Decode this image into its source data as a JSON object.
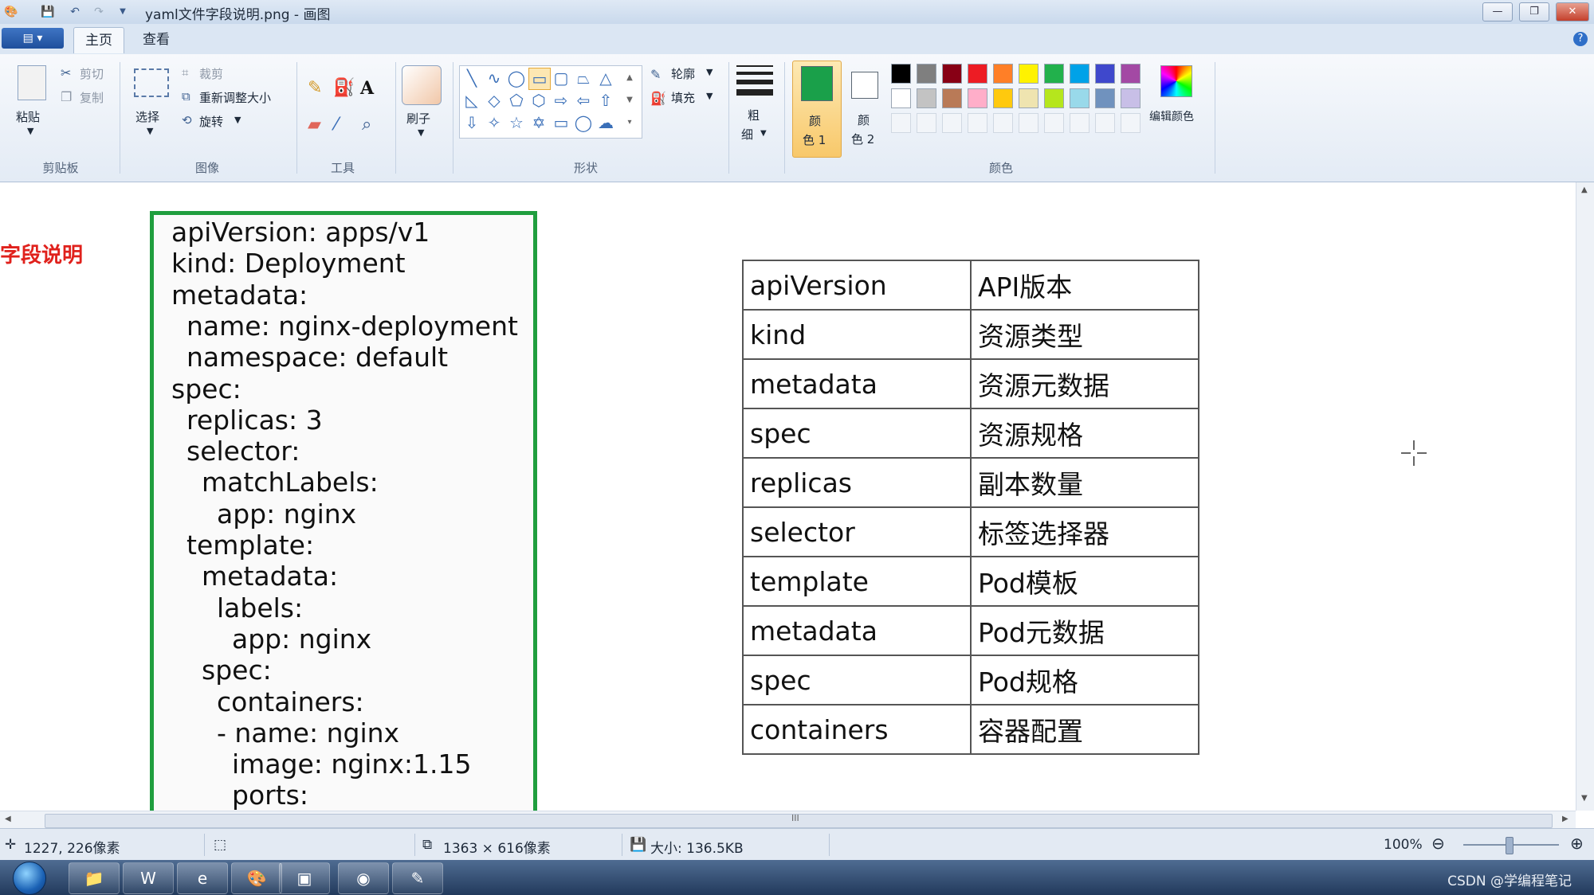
{
  "window": {
    "title": "yaml文件字段说明.png - 画图",
    "controls": {
      "minimize": "—",
      "restore": "❐",
      "close": "✕"
    }
  },
  "quick_access": {
    "icons": [
      "paint-app-icon",
      "save-icon",
      "undo-icon",
      "redo-icon",
      "customize-dropdown-icon"
    ]
  },
  "ribbon_tabs": {
    "app_menu": "▤ ▾",
    "home": "主页",
    "view": "查看",
    "help": "?"
  },
  "ribbon": {
    "clipboard": {
      "paste": "粘贴",
      "cut": "剪切",
      "copy": "复制",
      "group": "剪贴板"
    },
    "image": {
      "select": "选择",
      "crop": "裁剪",
      "resize": "重新调整大小",
      "rotate": "旋转",
      "group": "图像"
    },
    "tools": {
      "group": "工具"
    },
    "brush": {
      "label": "刷子"
    },
    "shapes": {
      "outline": "轮廓",
      "fill": "填充",
      "group": "形状"
    },
    "size": {
      "line1": "粗",
      "line2": "细"
    },
    "color1": {
      "line1": "颜",
      "line2": "色 1",
      "value": "#1aa04a"
    },
    "color2": {
      "line1": "颜",
      "line2": "色 2",
      "value": "#ffffff"
    },
    "edit_colors": "编辑颜色",
    "colors_group": "颜色",
    "palette_row1": [
      "#000000",
      "#7f7f7f",
      "#880015",
      "#ed1c24",
      "#ff7f27",
      "#fff200",
      "#22b14c",
      "#00a2e8",
      "#3f48cc",
      "#a349a4"
    ],
    "palette_row2": [
      "#ffffff",
      "#c3c3c3",
      "#b97a57",
      "#ffaec9",
      "#ffc90e",
      "#efe4b0",
      "#b5e61d",
      "#99d9ea",
      "#7092be",
      "#c8bfe7"
    ]
  },
  "side_title": "字段说明",
  "yaml_lines": [
    "apiVersion: apps/v1",
    "kind: Deployment",
    "metadata:",
    "  name: nginx-deployment",
    "  namespace: default",
    "spec:",
    "  replicas: 3",
    "  selector:",
    "    matchLabels:",
    "      app: nginx",
    "  template:",
    "    metadata:",
    "      labels:",
    "        app: nginx",
    "    spec:",
    "      containers:",
    "      - name: nginx",
    "        image: nginx:1.15",
    "        ports:"
  ],
  "field_table": [
    {
      "field": "apiVersion",
      "desc": "API版本"
    },
    {
      "field": "kind",
      "desc": "资源类型"
    },
    {
      "field": "metadata",
      "desc": "资源元数据"
    },
    {
      "field": "spec",
      "desc": "资源规格"
    },
    {
      "field": "replicas",
      "desc": "副本数量"
    },
    {
      "field": "selector",
      "desc": "标签选择器"
    },
    {
      "field": "template",
      "desc": "Pod模板"
    },
    {
      "field": "metadata",
      "desc": "Pod元数据"
    },
    {
      "field": "spec",
      "desc": "Pod规格"
    },
    {
      "field": "containers",
      "desc": "容器配置"
    }
  ],
  "statusbar": {
    "cursor_pos": "1227, 226像素",
    "image_size": "1363 × 616像素",
    "file_size": "大小: 136.5KB",
    "zoom": "100%"
  },
  "taskbar": {
    "watermark": "CSDN @学编程笔记"
  },
  "scrollbar": {
    "grip": "III"
  }
}
